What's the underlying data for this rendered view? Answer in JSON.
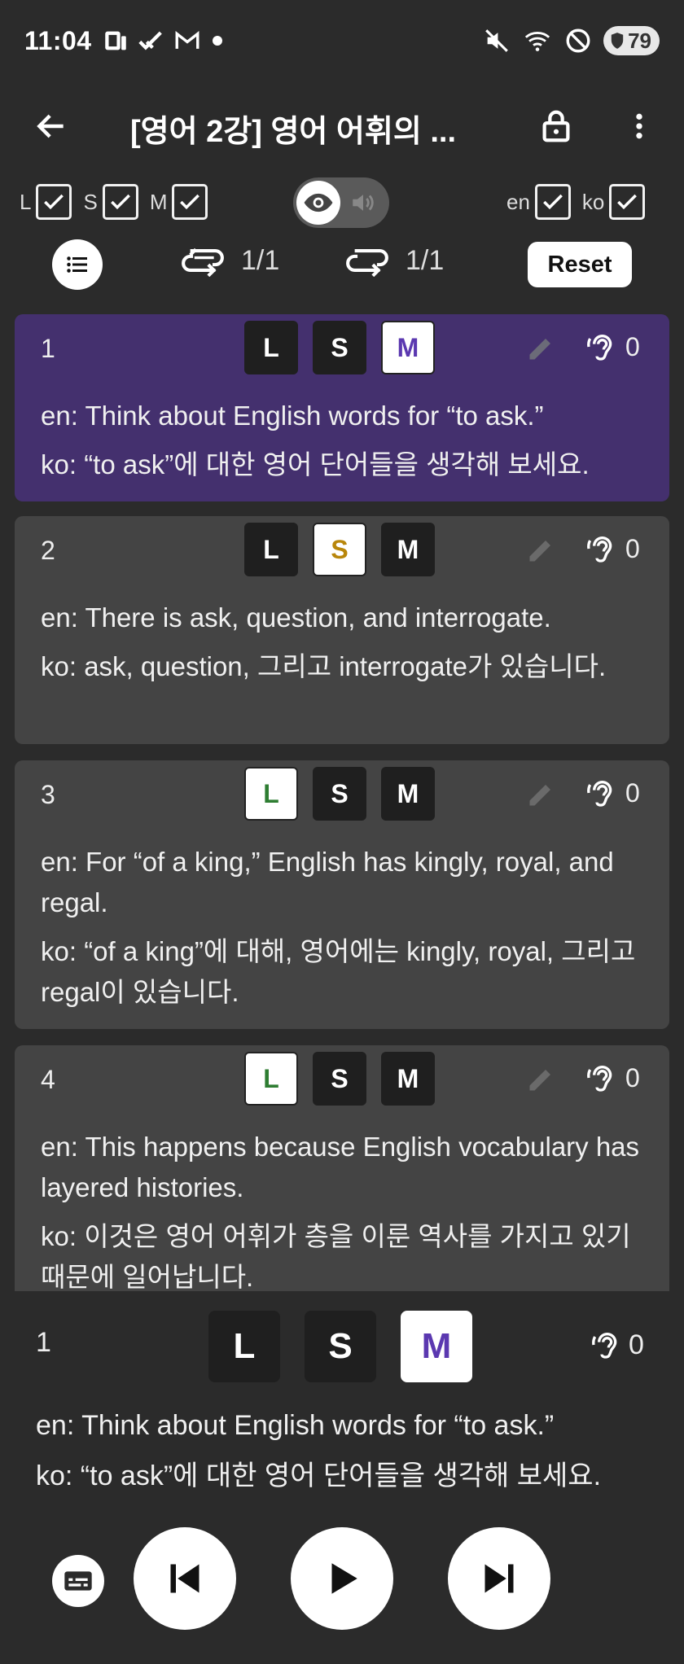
{
  "status_bar": {
    "time": "11:04",
    "battery": "79",
    "left_icons": [
      "device-icon",
      "check-icon",
      "gmail-icon",
      "dot-icon"
    ],
    "right_icons": [
      "mute-icon",
      "wifi-icon",
      "dnd-icon",
      "battery-icon"
    ]
  },
  "app_bar": {
    "title": "[영어 2강] 영어 어휘의 ..."
  },
  "filters": {
    "modes": [
      {
        "label": "L",
        "checked": true
      },
      {
        "label": "S",
        "checked": true
      },
      {
        "label": "M",
        "checked": true
      }
    ],
    "languages": [
      {
        "label": "en",
        "checked": true
      },
      {
        "label": "ko",
        "checked": true
      }
    ],
    "view_toggle": "eye"
  },
  "controls": {
    "repeat_all": "1/1",
    "repeat_one": "1/1",
    "reset_label": "Reset"
  },
  "sentences": [
    {
      "num": "1",
      "selected": "M",
      "listen_count": "0",
      "active": true,
      "en": "en: Think about English words for “to ask.”",
      "ko": "ko: “to ask”에 대한 영어 단어들을 생각해 보세요."
    },
    {
      "num": "2",
      "selected": "S",
      "listen_count": "0",
      "active": false,
      "en": "en: There is ask, question, and interrogate.",
      "ko": "ko: ask, question, 그리고 interrogate가 있습니다."
    },
    {
      "num": "3",
      "selected": "L",
      "listen_count": "0",
      "active": false,
      "en": "en: For “of a king,” English has kingly, royal, and regal.",
      "ko": "ko: “of a king”에 대해, 영어에는 kingly, royal, 그리고 regal이 있습니다."
    },
    {
      "num": "4",
      "selected": "L",
      "listen_count": "0",
      "active": false,
      "en": "en: This happens because English vocabulary has layered histories.",
      "ko": "ko: 이것은 영어 어휘가 층을 이룬 역사를 가지고 있기 때문에 일어납니다."
    }
  ],
  "lsm_labels": [
    "L",
    "S",
    "M"
  ],
  "lsm_colors": {
    "L": "#2e7d32",
    "S": "#b8860b",
    "M": "#5b38b0"
  },
  "now_playing": {
    "num": "1",
    "selected": "M",
    "listen_count": "0",
    "en": "en: Think about English words for “to ask.”",
    "ko": "ko: “to ask”에 대한 영어 단어들을 생각해 보세요."
  },
  "player_icons": [
    "subtitles-icon",
    "skip-previous-icon",
    "play-icon",
    "skip-next-icon"
  ]
}
